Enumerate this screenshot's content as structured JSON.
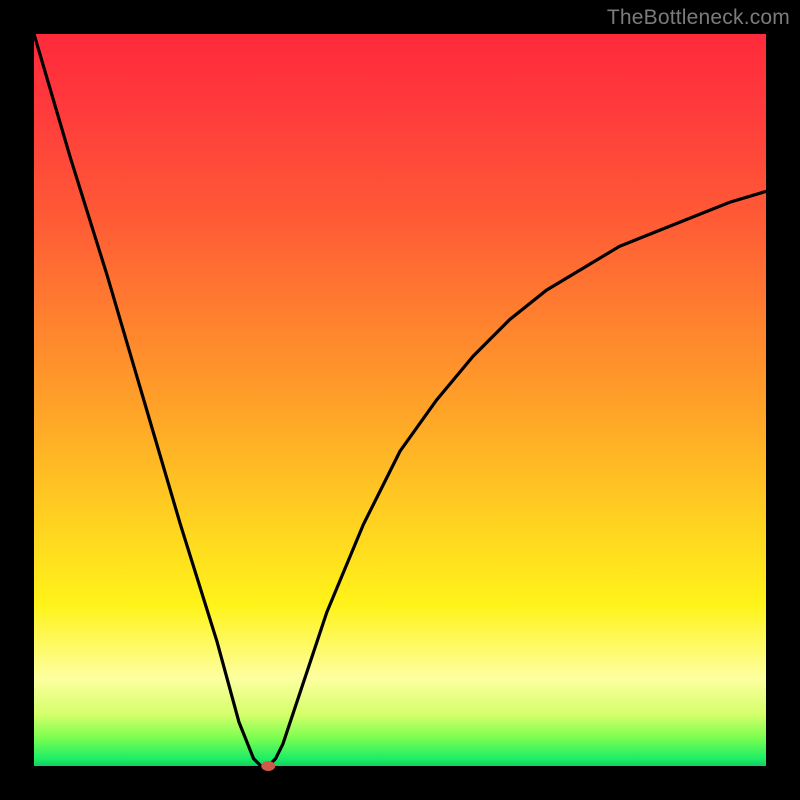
{
  "watermark": "TheBottleneck.com",
  "colors": {
    "frame": "#000000",
    "curve": "#000000",
    "marker": "#d05a4a",
    "gradient_top": "#ff2a3c",
    "gradient_bottom": "#10d060"
  },
  "chart_data": {
    "type": "line",
    "title": "",
    "xlabel": "",
    "ylabel": "",
    "xlim": [
      0,
      100
    ],
    "ylim": [
      0,
      100
    ],
    "x": [
      0,
      5,
      10,
      15,
      20,
      25,
      28,
      30,
      31,
      32,
      33,
      34,
      36,
      38,
      40,
      45,
      50,
      55,
      60,
      65,
      70,
      75,
      80,
      85,
      90,
      95,
      100
    ],
    "values": [
      100,
      83,
      67,
      50,
      33,
      17,
      6,
      1,
      0,
      0,
      1,
      3,
      9,
      15,
      21,
      33,
      43,
      50,
      56,
      61,
      65,
      68,
      71,
      73,
      75,
      77,
      78.5
    ],
    "marker": {
      "x": 32,
      "y": 0
    },
    "note": "Values are approximate, read visually from the plot. x and y are in percent of the plot area; y=0 at bottom, y=100 at top."
  }
}
